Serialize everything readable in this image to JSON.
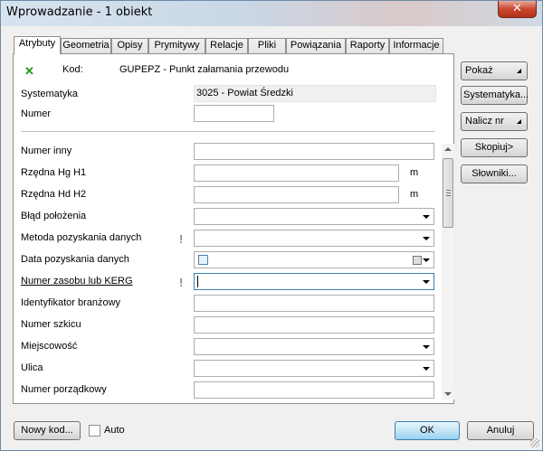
{
  "window": {
    "title": "Wprowadzanie - 1 obiekt",
    "close_label": "✕"
  },
  "tabs": [
    {
      "label": "Atrybuty",
      "active": true
    },
    {
      "label": "Geometria"
    },
    {
      "label": "Opisy"
    },
    {
      "label": "Prymitywy"
    },
    {
      "label": "Relacje"
    },
    {
      "label": "Pliki"
    },
    {
      "label": "Powiązania"
    },
    {
      "label": "Raporty"
    },
    {
      "label": "Informacje"
    }
  ],
  "header": {
    "kod_label": "Kod:",
    "kod_value": "GUPEPZ - Punkt załamania przewodu",
    "systematyka_label": "Systematyka",
    "systematyka_value": "3025 - Powiat Średzki",
    "numer_label": "Numer",
    "numer_value": ""
  },
  "fields": [
    {
      "label": "Numer inny",
      "value": ""
    },
    {
      "label": "Rzędna Hg H1",
      "value": "",
      "unit": "m"
    },
    {
      "label": "Rzędna Hd H2",
      "value": "",
      "unit": "m"
    },
    {
      "label": "Błąd położenia",
      "value": ""
    },
    {
      "label": "Metoda pozyskania danych",
      "value": "",
      "required": "!"
    },
    {
      "label": "Data pozyskania danych",
      "value": ""
    },
    {
      "label": "Numer zasobu lub KERG",
      "value": "",
      "required": "!"
    },
    {
      "label": "Identyfikator branżowy",
      "value": ""
    },
    {
      "label": "Numer szkicu",
      "value": ""
    },
    {
      "label": "Miejscowość",
      "value": ""
    },
    {
      "label": "Ulica",
      "value": ""
    },
    {
      "label": "Numer porządkowy",
      "value": ""
    }
  ],
  "side_buttons": {
    "pokaz": "Pokaż",
    "systematyka": "Systematyka...",
    "nalicz": "Nalicz nr",
    "skopiuj": "Skopiuj>",
    "slowniki": "Słowniki..."
  },
  "bottom": {
    "nowy_kod": "Nowy kod...",
    "auto": "Auto",
    "auto_checked": false,
    "ok": "OK",
    "anuluj": "Anuluj"
  },
  "icons": {
    "kod_status": "green-x-icon"
  }
}
